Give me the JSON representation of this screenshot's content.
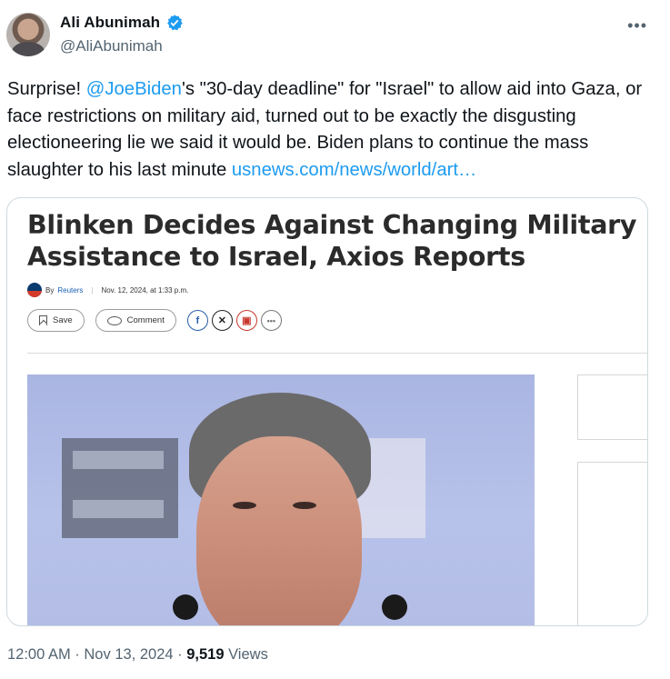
{
  "author": {
    "display_name": "Ali Abunimah",
    "handle": "@AliAbunimah",
    "verified": true
  },
  "tweet": {
    "text_before_mention": "Surprise! ",
    "mention": "@JoeBiden",
    "text_after_mention": "'s \"30-day deadline\" for \"Israel\" to allow aid into Gaza, or face restrictions on military aid, turned out to be exactly the disgusting electioneering lie we said it would be. Biden plans to continue the mass slaughter to his last minute ",
    "link_text": "usnews.com/news/world/art…"
  },
  "card": {
    "headline": "Blinken Decides Against Changing Military Assistance to Israel, Axios Reports",
    "byline_prefix": "By",
    "byline_author": "Reuters",
    "byline_date": "Nov. 12, 2024, at 1:33 p.m.",
    "save_label": "Save",
    "comment_label": "Comment"
  },
  "meta": {
    "time": "12:00 AM",
    "separator": " · ",
    "date": "Nov 13, 2024",
    "views_count": "9,519",
    "views_label": " Views"
  },
  "colors": {
    "link": "#1d9bf0",
    "verified": "#1d9bf0",
    "muted": "#536471"
  }
}
